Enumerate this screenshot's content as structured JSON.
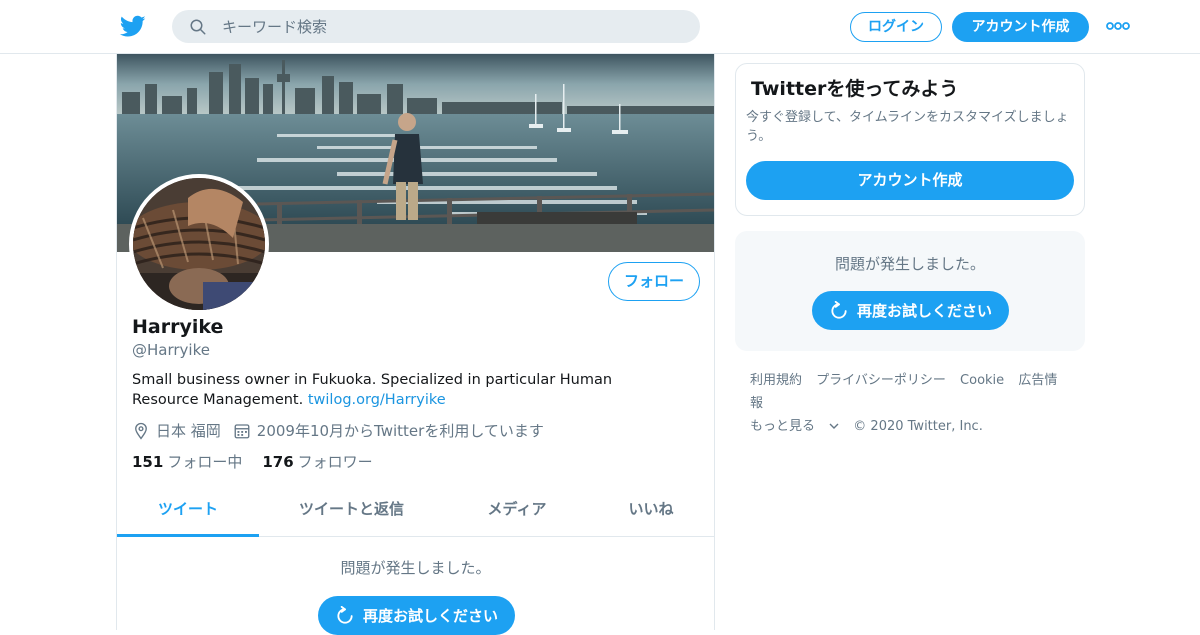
{
  "header": {
    "logo": "twitter-bird-icon",
    "search_placeholder": "キーワード検索",
    "login_label": "ログイン",
    "signup_label": "アカウント作成",
    "more_icon": "more-dots-icon"
  },
  "profile": {
    "name": "Harryike",
    "handle": "@Harryike",
    "bio_text": "Small business owner in Fukuoka. Specialized in particular Human Resource Management. ",
    "bio_link": "twilog.org/Harryike",
    "location": "日本 福岡",
    "joined": "2009年10月からTwitterを利用しています",
    "following_count": "151",
    "following_label": "フォロー中",
    "followers_count": "176",
    "followers_label": "フォロワー",
    "follow_button": "フォロー"
  },
  "tabs": [
    {
      "label": "ツイート",
      "active": true
    },
    {
      "label": "ツイートと返信",
      "active": false
    },
    {
      "label": "メディア",
      "active": false
    },
    {
      "label": "いいね",
      "active": false
    }
  ],
  "timeline": {
    "error_text": "問題が発生しました。",
    "retry_label": "再度お試しください"
  },
  "sidebar": {
    "signup_card": {
      "title": "Twitterを使ってみよう",
      "description": "今すぐ登録して、タイムラインをカスタマイズしましょう。",
      "button": "アカウント作成"
    },
    "error_card": {
      "error_text": "問題が発生しました。",
      "retry_label": "再度お試しください"
    },
    "footer_links": [
      "利用規約",
      "プライバシーポリシー",
      "Cookie",
      "広告情報",
      "もっと見る"
    ],
    "copyright": "© 2020 Twitter, Inc."
  },
  "colors": {
    "brand": "#1da1f2",
    "text_secondary": "#657786",
    "border": "#e1e8ed"
  }
}
